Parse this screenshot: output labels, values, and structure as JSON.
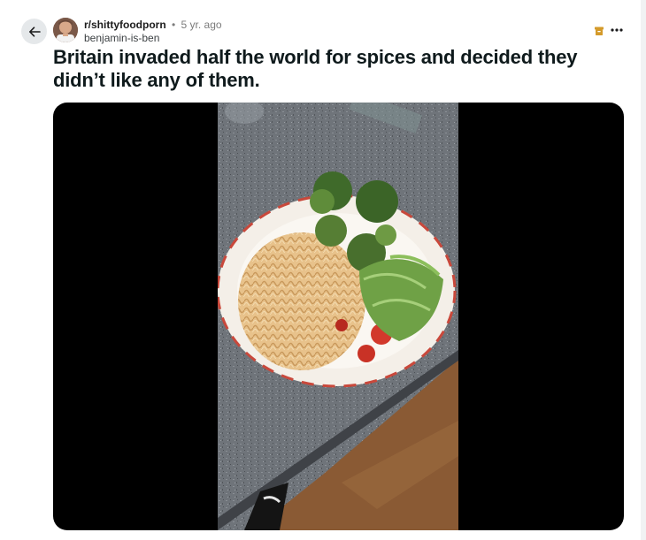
{
  "post": {
    "subreddit": "r/shittyfoodporn",
    "separator": "•",
    "age": "5 yr. ago",
    "author": "benjamin-is-ben",
    "title": "Britain invaded half the world for spices and decided they didn’t like any of them."
  },
  "icons": {
    "back": "back-arrow-icon",
    "archive": "archive-icon",
    "more": "more-options-icon"
  },
  "colors": {
    "accent_archive": "#d49a2a",
    "button_bg": "#e5e8ea",
    "title_text": "#0f1a1c"
  }
}
